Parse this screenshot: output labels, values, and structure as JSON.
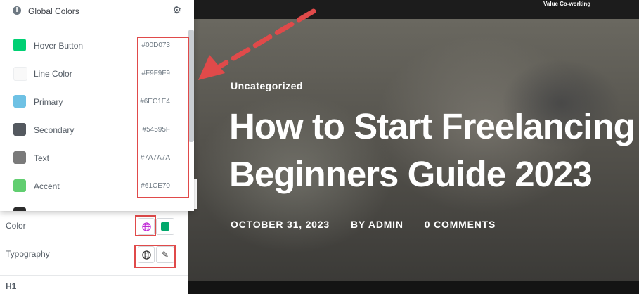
{
  "global_colors": {
    "title": "Global Colors",
    "info_icon_glyph": "i",
    "settings_icon_glyph": "⚙",
    "items": [
      {
        "name": "Hover Button",
        "hex": "#00D073",
        "swatch": "#00D073"
      },
      {
        "name": "Line Color",
        "hex": "#F9F9F9",
        "swatch": "#F9F9F9"
      },
      {
        "name": "Primary",
        "hex": "#6EC1E4",
        "swatch": "#6EC1E4"
      },
      {
        "name": "Secondary",
        "hex": "#54595F",
        "swatch": "#54595F"
      },
      {
        "name": "Text",
        "hex": "#7A7A7A",
        "swatch": "#7A7A7A"
      },
      {
        "name": "Accent",
        "hex": "#61CE70",
        "swatch": "#61CE70"
      }
    ]
  },
  "editor": {
    "color_label": "Color",
    "typography_label": "Typography",
    "h1_label": "H1",
    "edit_icon_glyph": "✎",
    "handle_glyph": "⋮"
  },
  "preview": {
    "brand": "Value Co-working",
    "category": "Uncategorized",
    "title_line1": "How to Start Freelancing",
    "title_line2": "Beginners Guide 2023",
    "meta_date": "OCTOBER 31, 2023",
    "meta_sep": "_",
    "meta_author": "BY ADMIN",
    "meta_comments": "0 COMMENTS"
  },
  "colors": {
    "annotation_red": "#E04A4A",
    "globe_active": "#C02BD6"
  }
}
